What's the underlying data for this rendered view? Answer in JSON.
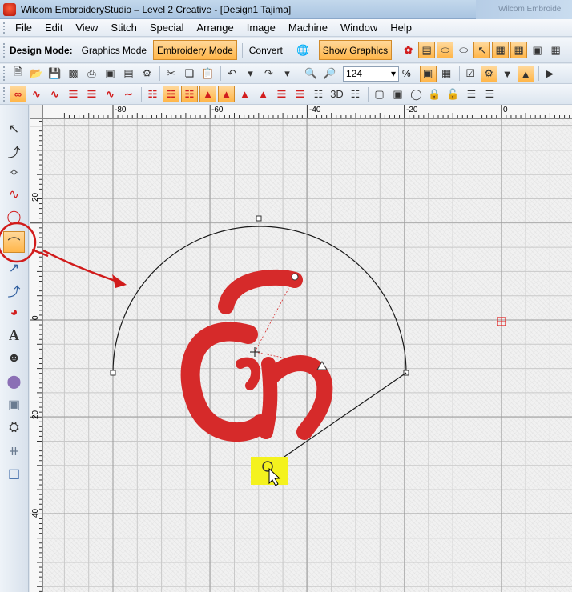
{
  "window": {
    "title": "Wilcom EmbroideryStudio – Level 2 Creative - [Design1          Tajima]",
    "background_window_title": "Wilcom Embroide"
  },
  "menu": [
    "File",
    "Edit",
    "View",
    "Stitch",
    "Special",
    "Arrange",
    "Image",
    "Machine",
    "Window",
    "Help"
  ],
  "mode_toolbar": {
    "label": "Design Mode:",
    "graphics_mode": "Graphics Mode",
    "embroidery_mode": "Embroidery Mode",
    "convert": "Convert",
    "show_graphics": "Show Graphics",
    "icons": [
      "satin-stitch-icon",
      "fill-stitch-icon",
      "outline-icon",
      "lasso-icon",
      "select-icon",
      "grid-icon",
      "table-icon",
      "image-icon",
      "color-icon"
    ]
  },
  "standard_toolbar": {
    "zoom_value": "124",
    "zoom_unit": "%"
  },
  "rulers": {
    "top_labels": [
      "-80",
      "-60",
      "-40",
      "-20",
      "0"
    ],
    "left_labels": [
      "20",
      "0",
      "20",
      "40"
    ]
  },
  "canvas": {
    "lettering_text": "En",
    "thread_color": "#d62a2a",
    "callout_highlight_color": "#f4f21e",
    "active_tool_circle_color": "#d11b1b"
  },
  "left_tools": [
    "select-object-icon",
    "reshape-icon",
    "knife-icon",
    "stitch-edit-icon",
    "transform-icon",
    "lettering-baseline-icon",
    "polyline-icon",
    "curve-icon",
    "circle-arc-icon",
    "lettering-icon",
    "monogram-icon",
    "badge-icon",
    "appliqué-icon",
    "team-names-icon",
    "branching-icon",
    "align-icon"
  ]
}
